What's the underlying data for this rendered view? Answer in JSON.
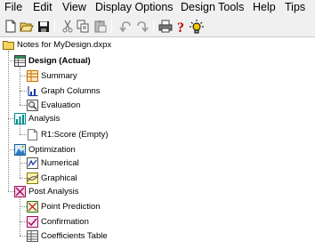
{
  "menu": [
    "File",
    "Edit",
    "View",
    "Display Options",
    "Design Tools",
    "Help",
    "Tips"
  ],
  "toolbar": {
    "buttons": [
      "new-document",
      "open-folder",
      "save",
      "cut",
      "copy",
      "paste",
      "undo",
      "redo",
      "print",
      "help",
      "tips"
    ]
  },
  "tree": {
    "root": "Notes for MyDesign.dxpx",
    "design": {
      "label": "Design (Actual)",
      "children": [
        "Summary",
        "Graph Columns",
        "Evaluation"
      ]
    },
    "analysis": {
      "label": "Analysis",
      "children": [
        "R1:Score (Empty)"
      ]
    },
    "optimization": {
      "label": "Optimization",
      "children": [
        "Numerical",
        "Graphical"
      ]
    },
    "post_analysis": {
      "label": "Post Analysis",
      "children": [
        "Point Prediction",
        "Confirmation",
        "Coefficients Table"
      ]
    }
  },
  "colors": {
    "help_icon": "#c00000",
    "bulb_icon": "#f2c500"
  }
}
